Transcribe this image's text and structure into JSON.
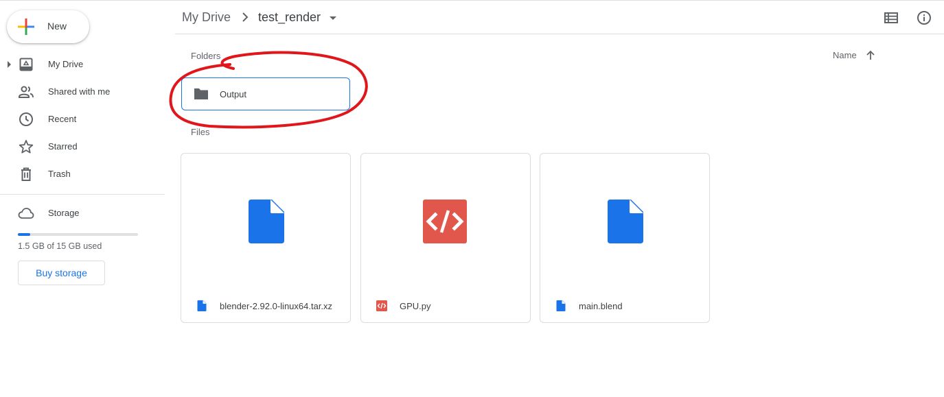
{
  "sidebar": {
    "new_label": "New",
    "items": [
      {
        "label": "My Drive",
        "icon": "my-drive-icon"
      },
      {
        "label": "Shared with me",
        "icon": "shared-icon"
      },
      {
        "label": "Recent",
        "icon": "clock-icon"
      },
      {
        "label": "Starred",
        "icon": "star-icon"
      },
      {
        "label": "Trash",
        "icon": "trash-icon"
      }
    ],
    "storage": {
      "label": "Storage",
      "icon": "cloud-icon",
      "used_text": "1.5 GB of 15 GB used",
      "used_fraction": 0.1,
      "buy_label": "Buy storage"
    }
  },
  "header": {
    "breadcrumb_root": "My Drive",
    "breadcrumb_current": "test_render",
    "icons": [
      "list-view-icon",
      "info-icon"
    ]
  },
  "main": {
    "folders_title": "Folders",
    "files_title": "Files",
    "sort_label": "Name",
    "folders": [
      {
        "name": "Output"
      }
    ],
    "files": [
      {
        "name": "blender-2.92.0-linux64.tar.xz",
        "type": "document",
        "icon_color": "#1a73e8"
      },
      {
        "name": "GPU.py",
        "type": "code",
        "icon_color": "#e2574c"
      },
      {
        "name": "main.blend",
        "type": "document",
        "icon_color": "#1a73e8"
      }
    ]
  },
  "colors": {
    "accent": "#1a73e8",
    "annotation": "#e0161b"
  }
}
